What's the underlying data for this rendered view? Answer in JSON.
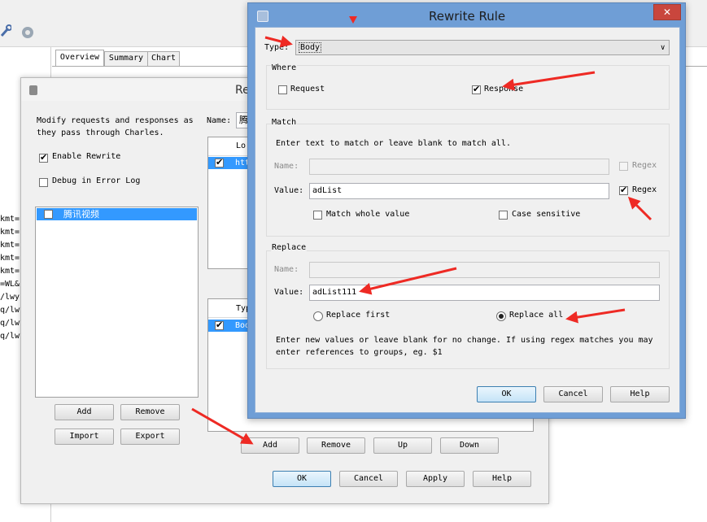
{
  "background_window": {
    "tabs": [
      "Overview",
      "Summary",
      "Chart"
    ],
    "log_fragments": [
      "kmt=",
      "kmt=",
      "kmt=",
      "kmt=",
      "kmt=",
      "=WL&",
      "/lwy",
      "q/lwy",
      "q/lwy",
      "q/lwy"
    ]
  },
  "rewrite_settings": {
    "title": "Re",
    "description": "Modify requests and responses as they pass through Charles.",
    "enable_rewrite": "Enable Rewrite",
    "debug_log": "Debug in Error Log",
    "sets": [
      "腾讯视频"
    ],
    "name_label": "Name:",
    "name_value": "腾",
    "locations_header": "Lo",
    "locations_row": "htt",
    "rules_header": "Typ",
    "rules_row": "Bod",
    "buttons": {
      "add": "Add",
      "remove": "Remove",
      "import": "Import",
      "export": "Export",
      "rule_add": "Add",
      "rule_remove": "Remove",
      "up": "Up",
      "down": "Down",
      "ok": "OK",
      "cancel": "Cancel",
      "apply": "Apply",
      "help": "Help"
    }
  },
  "rewrite_rule": {
    "title": "Rewrite Rule",
    "close": "✕",
    "type_label": "Type:",
    "type_value": "Body",
    "where": {
      "title": "Where",
      "request": "Request",
      "response": "Response"
    },
    "match": {
      "title": "Match",
      "hint": "Enter text to match or leave blank to match all.",
      "name_label": "Name:",
      "value_label": "Value:",
      "value": "adList",
      "regex": "Regex",
      "match_whole": "Match whole value",
      "case_sensitive": "Case sensitive"
    },
    "replace": {
      "title": "Replace",
      "name_label": "Name:",
      "value_label": "Value:",
      "value": "adList111",
      "replace_first": "Replace first",
      "replace_all": "Replace all",
      "hint": "Enter new values or leave blank for no change. If using regex matches you may enter references to groups, eg. $1"
    },
    "buttons": {
      "ok": "OK",
      "cancel": "Cancel",
      "help": "Help"
    }
  },
  "colors": {
    "title_bar": "#6f9ed6",
    "selection": "#3399ff",
    "annotation": "#ee2a24"
  }
}
